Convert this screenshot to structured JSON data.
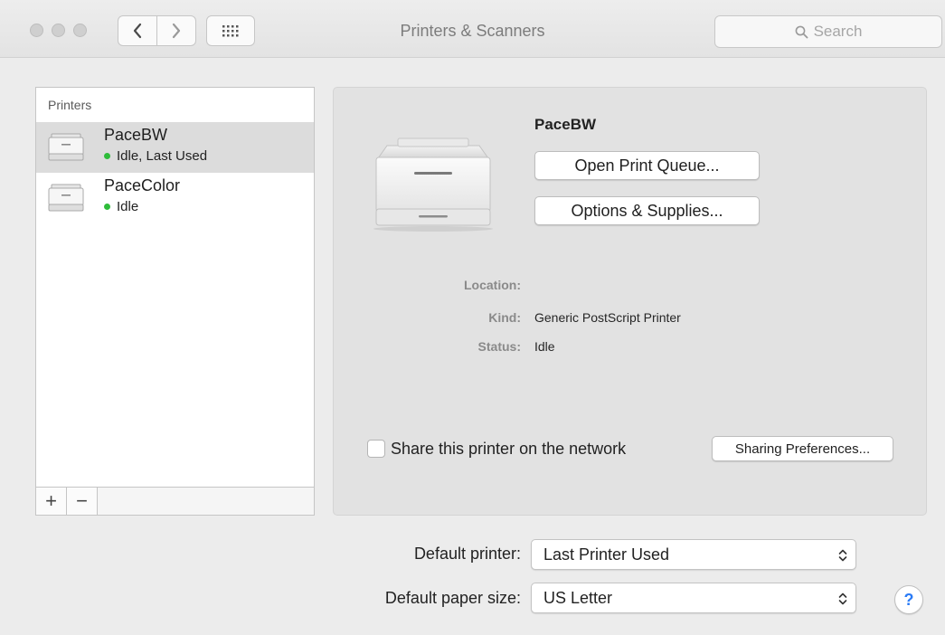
{
  "window": {
    "title": "Printers & Scanners"
  },
  "search": {
    "placeholder": "Search"
  },
  "printer_list": {
    "header": "Printers",
    "items": [
      {
        "name": "PaceBW",
        "status": "Idle, Last Used",
        "selected": true,
        "status_color": "#2ebc3a"
      },
      {
        "name": "PaceColor",
        "status": "Idle",
        "selected": false,
        "status_color": "#2ebc3a"
      }
    ],
    "add_label": "+",
    "remove_label": "−"
  },
  "detail": {
    "name": "PaceBW",
    "open_queue_label": "Open Print Queue...",
    "options_label": "Options & Supplies...",
    "location_label": "Location:",
    "location_value": "",
    "kind_label": "Kind:",
    "kind_value": "Generic PostScript Printer",
    "status_label": "Status:",
    "status_value": "Idle",
    "share_label": "Share this printer on the network",
    "share_checked": false,
    "sharing_prefs_label": "Sharing Preferences..."
  },
  "defaults": {
    "printer_label": "Default printer:",
    "printer_value": "Last Printer Used",
    "paper_label": "Default paper size:",
    "paper_value": "US Letter"
  },
  "help": {
    "label": "?"
  }
}
